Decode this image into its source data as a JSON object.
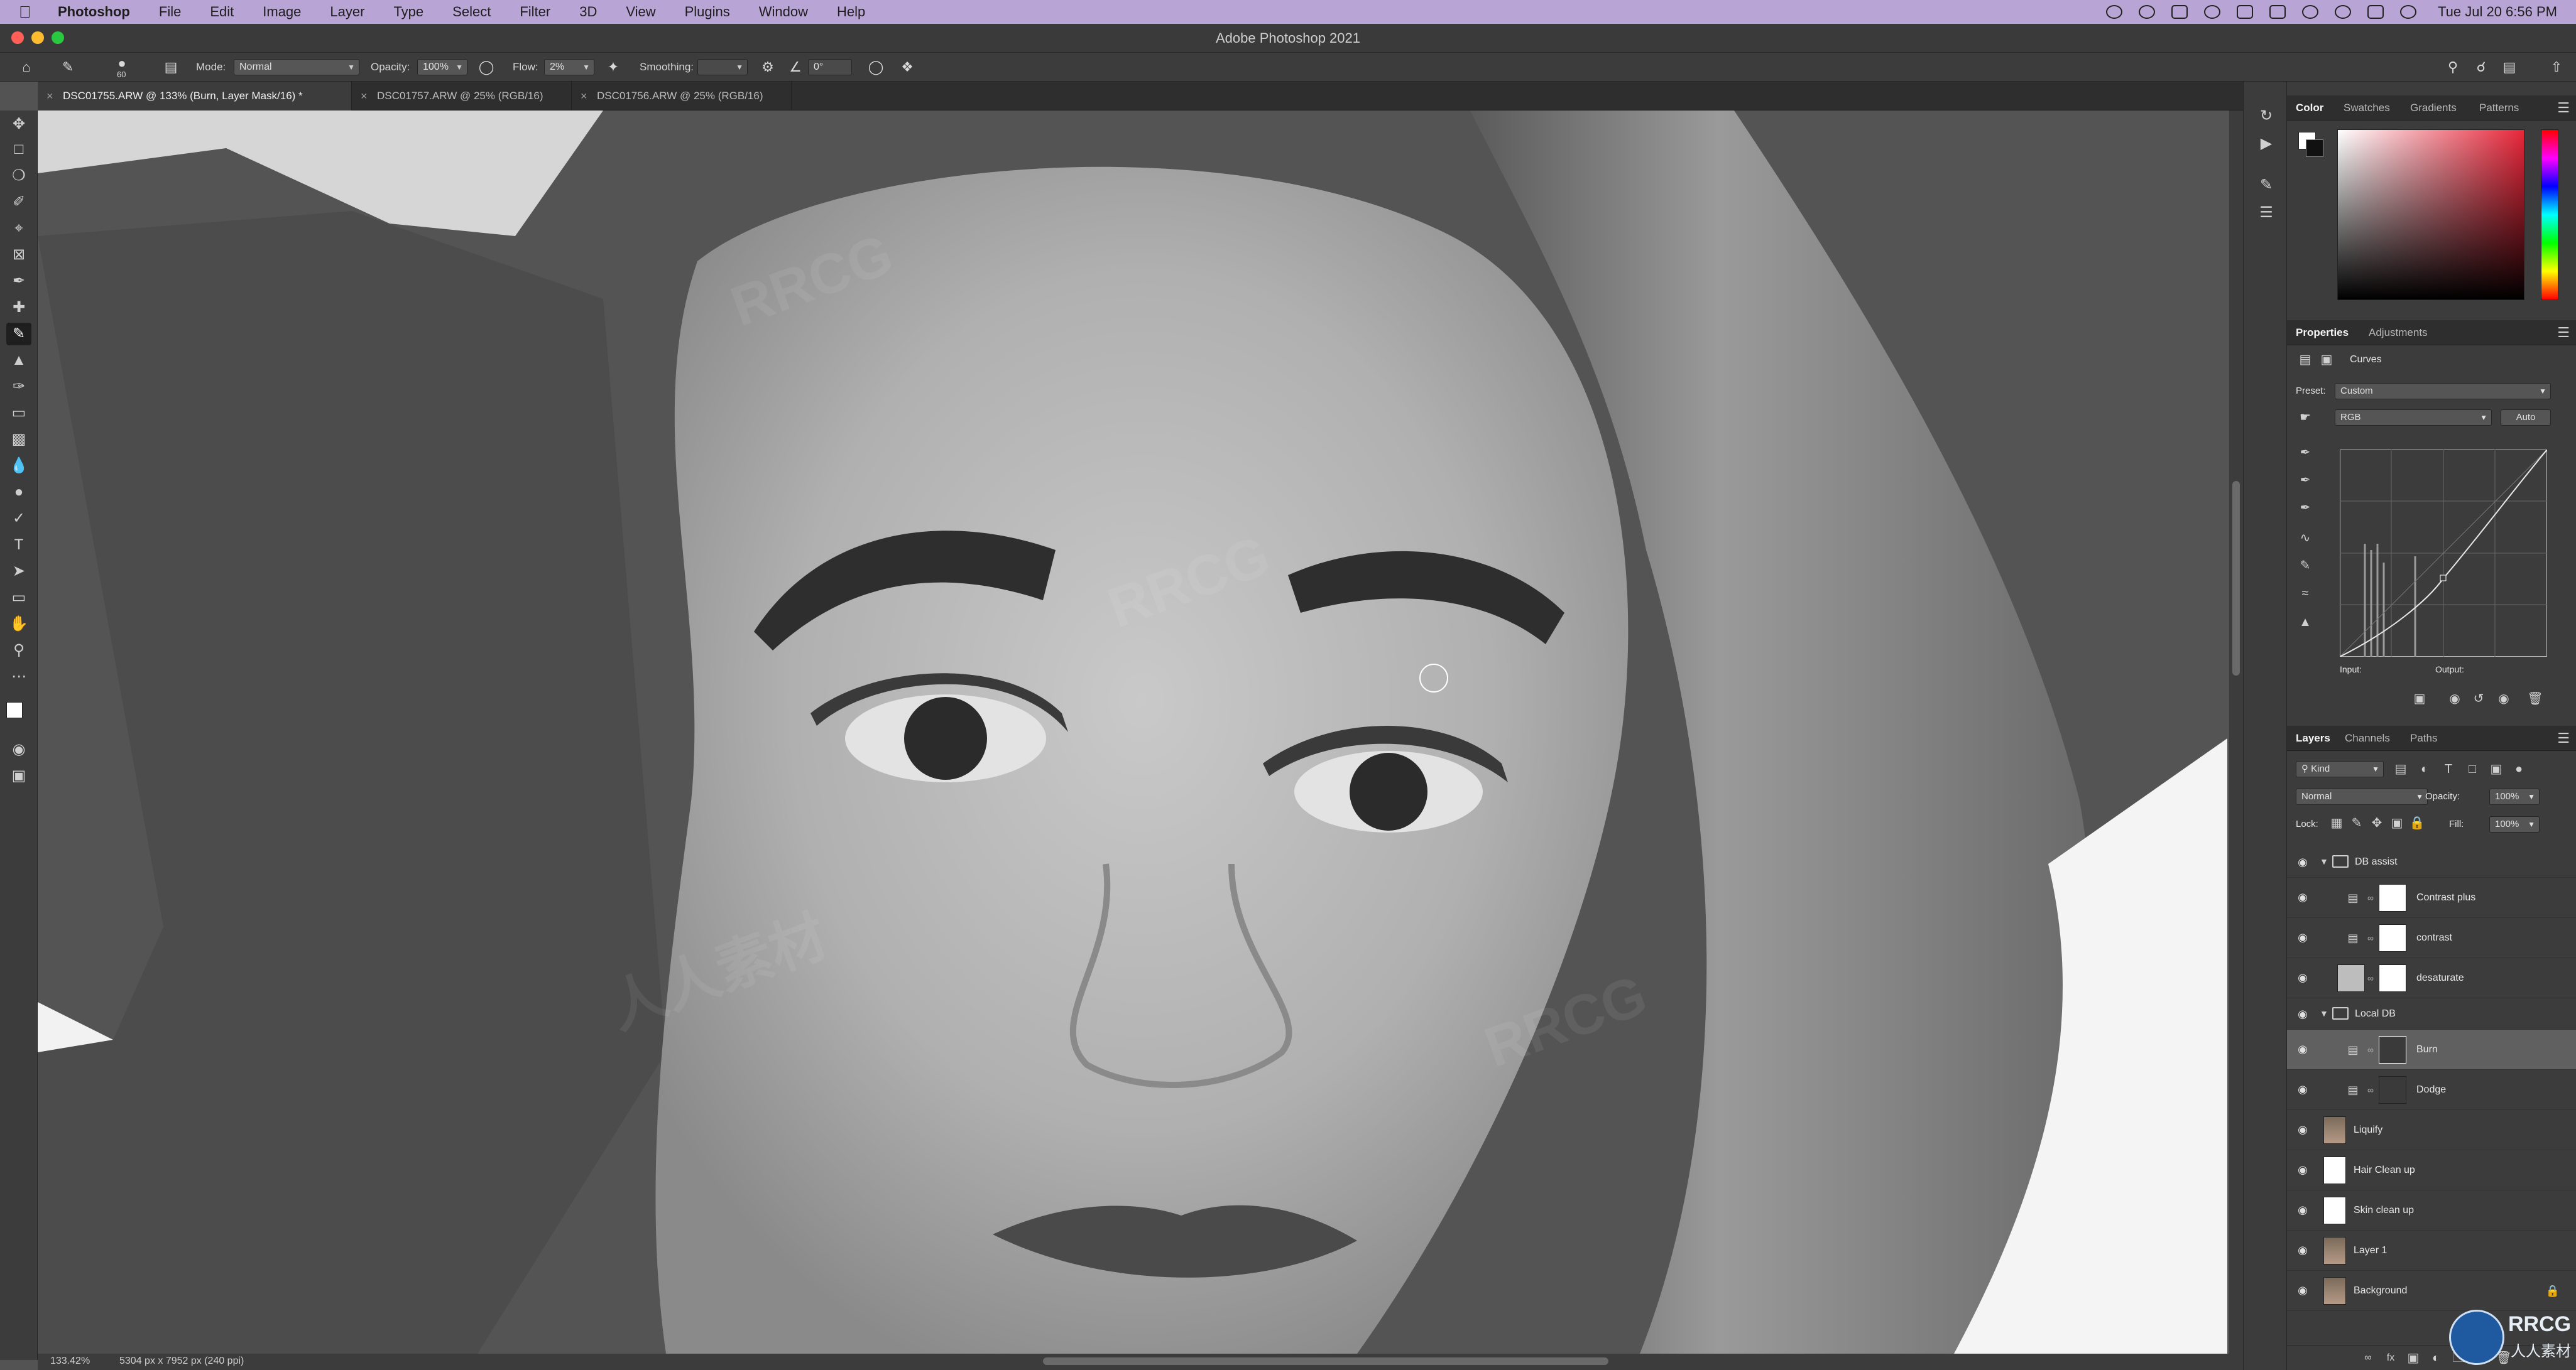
{
  "menubar": {
    "app": "Photoshop",
    "items": [
      "File",
      "Edit",
      "Image",
      "Layer",
      "Type",
      "Select",
      "Filter",
      "3D",
      "View",
      "Plugins",
      "Window",
      "Help"
    ],
    "clock": "Tue Jul 20  6:56 PM"
  },
  "window": {
    "title": "Adobe Photoshop 2021"
  },
  "options": {
    "brush_size": "60",
    "mode_label": "Mode:",
    "mode_value": "Normal",
    "opacity_label": "Opacity:",
    "opacity_value": "100%",
    "flow_label": "Flow:",
    "flow_value": "2%",
    "smoothing_label": "Smoothing:",
    "angle_value": "0°"
  },
  "tabs": [
    {
      "label": "DSC01755.ARW @ 133% (Burn, Layer Mask/16) *"
    },
    {
      "label": "DSC01757.ARW @ 25% (RGB/16)"
    },
    {
      "label": "DSC01756.ARW @ 25% (RGB/16)"
    }
  ],
  "status": {
    "zoom": "133.42%",
    "dims": "5304 px x 7952 px (240 ppi)"
  },
  "color_panel": {
    "tabs": [
      "Color",
      "Swatches",
      "Gradients",
      "Patterns"
    ]
  },
  "properties_panel": {
    "tabs": [
      "Properties",
      "Adjustments"
    ],
    "adjustment": "Curves",
    "preset_label": "Preset:",
    "preset_value": "Custom",
    "channel_value": "RGB",
    "auto_label": "Auto",
    "input_label": "Input:",
    "output_label": "Output:"
  },
  "layers_panel": {
    "tabs": [
      "Layers",
      "Channels",
      "Paths"
    ],
    "kind_label": "Kind",
    "blend_mode": "Normal",
    "opacity_label": "Opacity:",
    "opacity_value": "100%",
    "lock_label": "Lock:",
    "fill_label": "Fill:",
    "fill_value": "100%",
    "layers": [
      {
        "name": "DB assist"
      },
      {
        "name": "Contrast plus"
      },
      {
        "name": "contrast"
      },
      {
        "name": "desaturate"
      },
      {
        "name": "Local DB"
      },
      {
        "name": "Burn"
      },
      {
        "name": "Dodge"
      },
      {
        "name": "Liquify"
      },
      {
        "name": "Hair Clean up"
      },
      {
        "name": "Skin clean up"
      },
      {
        "name": "Layer 1"
      },
      {
        "name": "Background"
      }
    ]
  },
  "watermark": {
    "text": "RRCG",
    "text_cn": "人人素材"
  },
  "colors": {
    "menubar": "#b9a4d6",
    "panel": "#3c3c3c",
    "dark": "#2e2e2e",
    "canvas_bg": "#555555"
  }
}
